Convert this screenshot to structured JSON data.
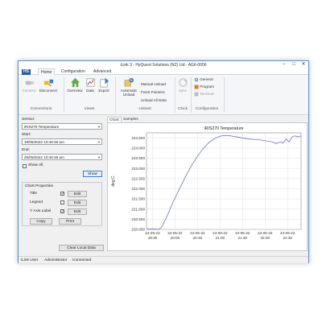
{
  "window": {
    "title": "iLink 3 - HyQuest Solutions (NZ) Ltd - AG6-0006",
    "logo": "HS",
    "controls": [
      "–",
      "□",
      "✕"
    ]
  },
  "ribbon": {
    "tabs": [
      "Home",
      "Configuration",
      "Advanced"
    ],
    "connections": {
      "connect": "Connect",
      "disconnect": "Disconnect",
      "group": "Connections"
    },
    "views": {
      "overview": "Overview",
      "data": "Data",
      "export": "Export",
      "group": "Views"
    },
    "unload": {
      "automatic": "Automatic",
      "unload": "Unload",
      "manual": "Manual Unload",
      "fetch": "Fetch Pointers",
      "all": "Unload All Data",
      "group": "Unload"
    },
    "clock": {
      "sync": "Sync",
      "group": "Clock"
    },
    "configuration": {
      "general": "General",
      "program": "Program",
      "terminal": "Terminal",
      "group": "Configuration"
    }
  },
  "left": {
    "sensor_label": "Sensor:",
    "sensor_value": "iRIS270 Temperature",
    "start_label": "Start:",
    "start_value": "18/05/2022 10:46:36 am",
    "end_label": "End:",
    "end_value": "25/05/2022 10:46:36 am",
    "show_all": "Show All",
    "show_button": "Show",
    "chart_properties": "Chart Properties",
    "props": [
      {
        "label": "Title",
        "checked": "✓",
        "edit": "Edit"
      },
      {
        "label": "Legend",
        "checked": "",
        "edit": "Edit"
      },
      {
        "label": "Y Axis Label",
        "checked": "✓",
        "edit": "Edit"
      }
    ],
    "copy": "Copy",
    "print": "Print",
    "clear": "Clear Local Data"
  },
  "panel_tabs": [
    "Chart",
    "Samples"
  ],
  "chart_data": {
    "type": "line",
    "title": "iRIS270 Temperature",
    "ylabel": "deg C",
    "xlabel": "",
    "ylim": [
      220,
      224.75
    ],
    "yticks": [
      "224.500",
      "224.000",
      "223.500",
      "223.000",
      "222.500",
      "222.000",
      "221.500",
      "221.000",
      "220.500",
      "220.000"
    ],
    "ytick_values": [
      224.5,
      224.0,
      223.5,
      223.0,
      222.5,
      222.0,
      221.5,
      221.0,
      220.5,
      220.0
    ],
    "xticks": [
      {
        "date": "24-05-22",
        "time": "19:30",
        "t": 0
      },
      {
        "date": "24-05-22",
        "time": "20:00",
        "t": 30
      },
      {
        "date": "24-05-22",
        "time": "20:30",
        "t": 60
      },
      {
        "date": "24-05-22",
        "time": "21:00",
        "t": 90
      },
      {
        "date": "24-05-22",
        "time": "21:30",
        "t": 120
      },
      {
        "date": "24-05-22",
        "time": "22:00",
        "t": 150
      },
      {
        "date": "24-05-22",
        "time": "22:30",
        "t": 180
      }
    ],
    "xlim": [
      -8,
      198
    ],
    "series": [
      {
        "color": "#6b6fd8",
        "x": [
          -8,
          2,
          8,
          12,
          20,
          28,
          36,
          44,
          52,
          60,
          68,
          76,
          84,
          92,
          98,
          104,
          112,
          120,
          128,
          136,
          144,
          152,
          160,
          165,
          170,
          174,
          178,
          182,
          186,
          190,
          194,
          198
        ],
        "y": [
          220.02,
          220.03,
          220.0,
          220.1,
          220.7,
          221.4,
          222.0,
          222.6,
          223.15,
          223.6,
          224.0,
          224.3,
          224.5,
          224.6,
          224.62,
          224.6,
          224.55,
          224.5,
          224.45,
          224.42,
          224.4,
          224.35,
          224.3,
          224.22,
          224.3,
          224.25,
          224.45,
          224.3,
          224.55,
          224.6,
          224.55,
          224.6
        ]
      }
    ],
    "grid": true
  },
  "status": {
    "user_label": "iLink User",
    "user": "Administrator",
    "state": "Connected"
  }
}
